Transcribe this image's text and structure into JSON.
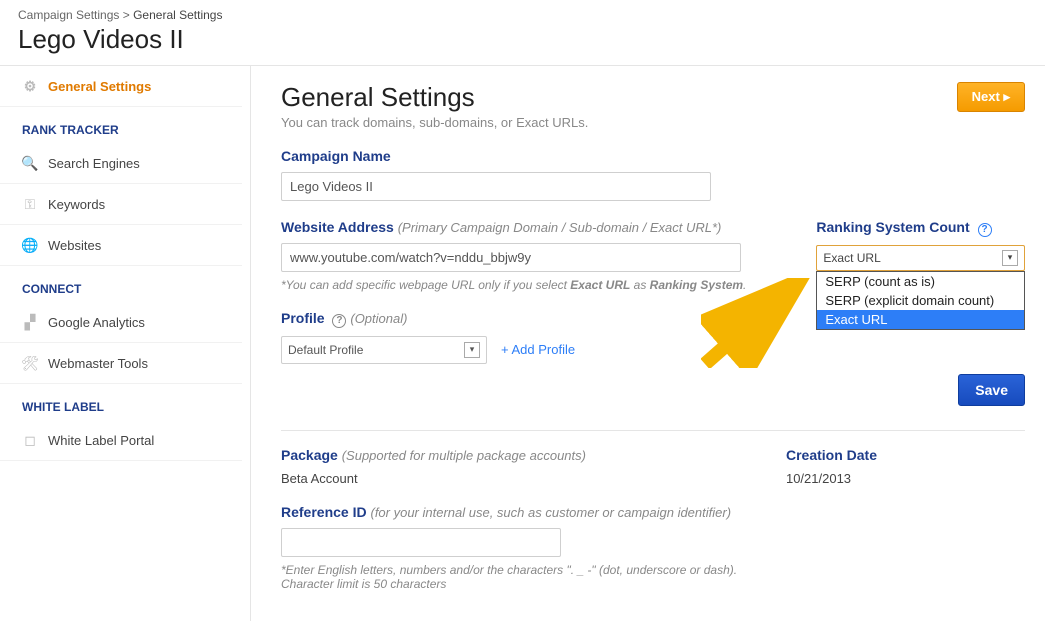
{
  "breadcrumb": {
    "parent": "Campaign Settings",
    "sep": ">",
    "current": "General Settings"
  },
  "page_title": "Lego Videos II",
  "sidebar": {
    "general": "General Settings",
    "sections": {
      "rank_tracker": "RANK TRACKER",
      "connect": "CONNECT",
      "white_label": "WHITE LABEL"
    },
    "items": {
      "search_engines": "Search Engines",
      "keywords": "Keywords",
      "websites": "Websites",
      "google_analytics": "Google Analytics",
      "webmaster_tools": "Webmaster Tools",
      "white_label_portal": "White Label Portal"
    }
  },
  "main": {
    "title": "General Settings",
    "subtitle": "You can track domains, sub-domains, or Exact URLs.",
    "next_label": "Next",
    "campaign_name": {
      "label": "Campaign Name",
      "value": "Lego Videos II"
    },
    "website": {
      "label": "Website Address",
      "hint": "(Primary Campaign Domain / Sub-domain / Exact URL*)",
      "value": "www.youtube.com/watch?v=nddu_bbjw9y",
      "note_prefix": "*You can add specific webpage URL only if you select ",
      "note_em1": "Exact URL",
      "note_mid": " as ",
      "note_em2": "Ranking System",
      "note_suffix": "."
    },
    "ranking": {
      "label": "Ranking System Count",
      "selected": "Exact URL",
      "options": [
        "SERP (count as is)",
        "SERP (explicit domain count)",
        "Exact URL"
      ]
    },
    "profile": {
      "label": "Profile",
      "hint": "(Optional)",
      "value": "Default Profile",
      "add": "+ Add Profile"
    },
    "save_label": "Save",
    "package": {
      "label": "Package",
      "hint": "(Supported for multiple package accounts)",
      "value": "Beta Account"
    },
    "creation": {
      "label": "Creation Date",
      "value": "10/21/2013"
    },
    "reference": {
      "label": "Reference ID",
      "hint": "(for your internal use, such as customer or campaign identifier)",
      "value": "",
      "note1": "*Enter English letters, numbers and/or the characters \". _ -\" (dot, underscore or dash).",
      "note2": "Character limit is 50 characters"
    }
  }
}
